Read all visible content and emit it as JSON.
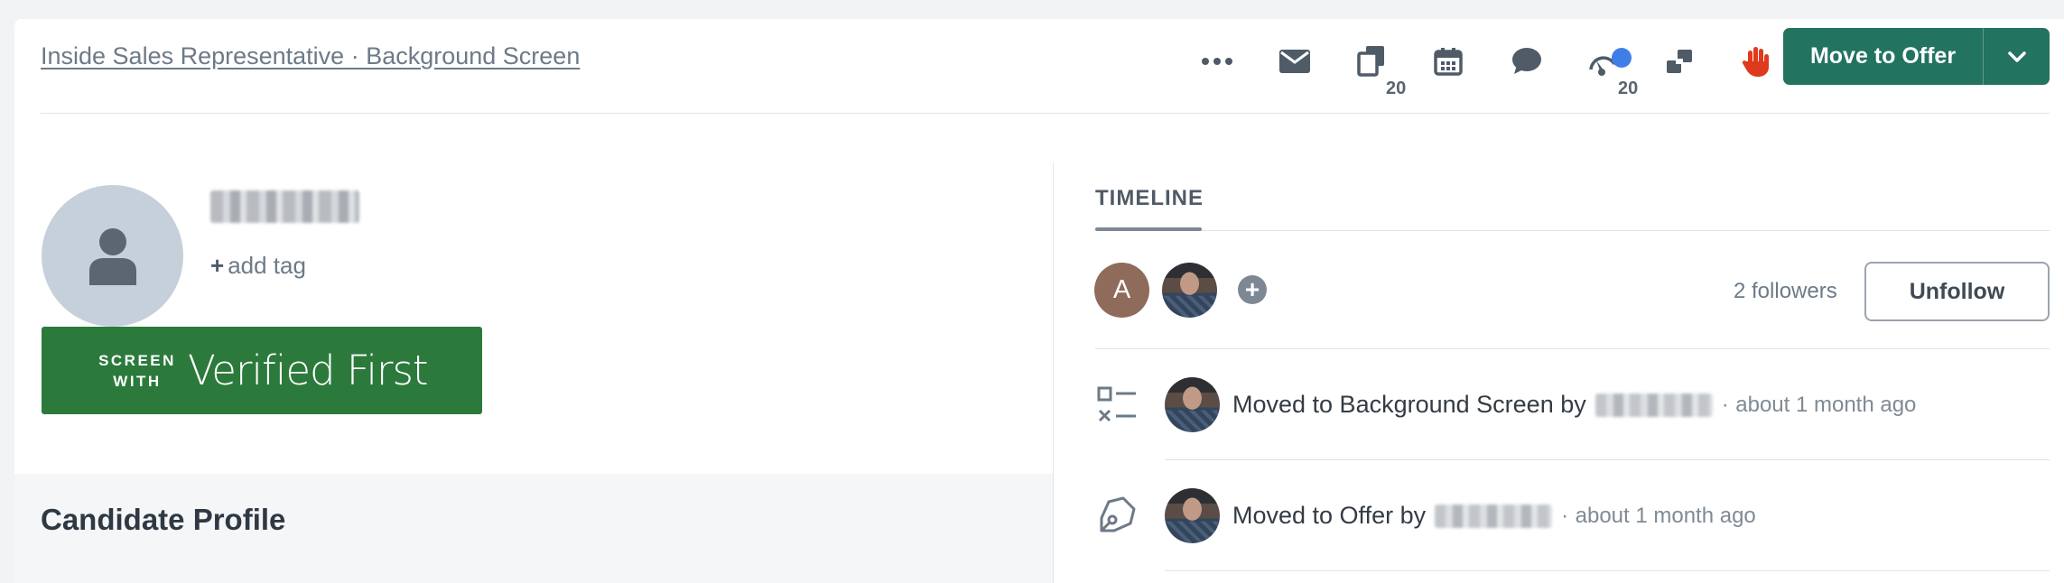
{
  "header": {
    "breadcrumb": "Inside Sales Representative · Background Screen",
    "actions": [
      {
        "name": "more-options",
        "icon": "ellipsis-icon"
      },
      {
        "name": "email",
        "icon": "envelope-icon"
      },
      {
        "name": "messages",
        "icon": "copy-icon",
        "count": "20"
      },
      {
        "name": "schedule",
        "icon": "calendar-icon"
      },
      {
        "name": "comment",
        "icon": "speech-bubble-icon"
      },
      {
        "name": "scorecards",
        "icon": "gauge-icon",
        "count": "20",
        "has_notification": true,
        "notification_color": "#3f7ee8"
      },
      {
        "name": "transfer",
        "icon": "transfer-arrows-icon"
      },
      {
        "name": "reject",
        "icon": "hand-stop-icon",
        "color": "#e03a1e"
      }
    ],
    "primary_action": "Move to Offer",
    "primary_color": "#22735f"
  },
  "candidate": {
    "add_tag_label": "add tag",
    "add_tag_symbol": "+"
  },
  "integration_banner": {
    "prefix_line1": "SCREEN",
    "prefix_line2": "WITH",
    "brand": "Verified First",
    "color": "#2b7a3c"
  },
  "profile": {
    "section_title": "Candidate Profile"
  },
  "timeline": {
    "tab_label": "TIMELINE",
    "followers": [
      {
        "initial": "A",
        "color": "#8f6b5c"
      },
      {
        "initial": "",
        "kind": "photo"
      }
    ],
    "add_follower_symbol": "+",
    "followers_count": "2 followers",
    "unfollow_label": "Unfollow",
    "events": [
      {
        "icon": "checklist-icon",
        "text": "Moved to Background Screen by",
        "separator": "·",
        "time": "about 1 month ago"
      },
      {
        "icon": "pen-nib-icon",
        "text": "Moved to Offer by",
        "separator": "·",
        "time": "about 1 month ago"
      }
    ]
  }
}
